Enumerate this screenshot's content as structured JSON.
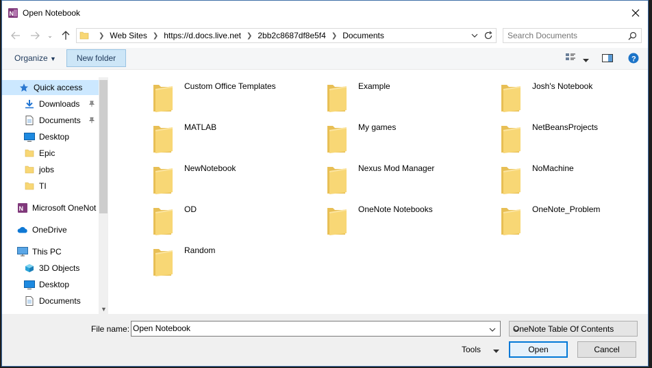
{
  "window": {
    "title": "Open Notebook"
  },
  "address": {
    "crumbs": [
      "Web Sites",
      "https://d.docs.live.net",
      "2bb2c8687df8e5f4",
      "Documents"
    ]
  },
  "search": {
    "placeholder": "Search Documents"
  },
  "toolbar": {
    "organize_label": "Organize",
    "new_folder_label": "New folder"
  },
  "nav": {
    "quick_access": "Quick access",
    "items": [
      {
        "label": "Downloads",
        "icon": "download-arrow-icon",
        "pinned": true
      },
      {
        "label": "Documents",
        "icon": "document-icon",
        "pinned": true
      },
      {
        "label": "Desktop",
        "icon": "desktop-icon",
        "pinned": false
      },
      {
        "label": "Epic",
        "icon": "folder-icon",
        "pinned": false
      },
      {
        "label": "jobs",
        "icon": "folder-icon",
        "pinned": false
      },
      {
        "label": "TI",
        "icon": "folder-icon",
        "pinned": false
      }
    ],
    "onenote": "Microsoft OneNot",
    "onedrive": "OneDrive",
    "this_pc": "This PC",
    "pc_items": [
      {
        "label": "3D Objects",
        "icon": "cube-icon"
      },
      {
        "label": "Desktop",
        "icon": "desktop-icon"
      },
      {
        "label": "Documents",
        "icon": "document-icon"
      }
    ]
  },
  "folders": [
    "Custom Office Templates",
    "Example",
    "Josh's Notebook",
    "MATLAB",
    "My games",
    "NetBeansProjects",
    "NewNotebook",
    "Nexus Mod Manager",
    "NoMachine",
    "OD",
    "OneNote Notebooks",
    "OneNote_Problem",
    "Random"
  ],
  "bottom": {
    "file_name_label": "File name:",
    "file_name_value": "Open Notebook",
    "file_type": "OneNote Table Of Contents",
    "tools_label": "Tools",
    "open_label": "Open",
    "cancel_label": "Cancel"
  },
  "colors": {
    "accent": "#0078d7",
    "folder": "#f8d775",
    "onenote": "#80397b"
  }
}
